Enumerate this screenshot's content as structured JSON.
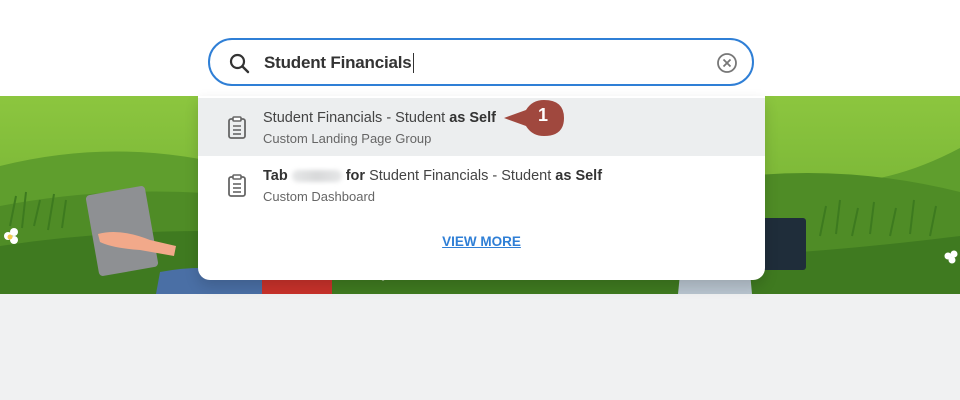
{
  "search": {
    "value": "Student Financials",
    "icon": "search-icon",
    "clear_icon": "clear-icon"
  },
  "results": [
    {
      "title_prefix": "Student Financials - Student ",
      "title_bold": "as Self",
      "subtitle": "Custom Landing Page Group",
      "icon": "clipboard-icon"
    },
    {
      "title_bold_1": "Tab",
      "title_bold_2": "for",
      "title_middle": "Student Financials - Student ",
      "title_bold_3": "as Self",
      "subtitle": "Custom Dashboard",
      "icon": "clipboard-icon"
    }
  ],
  "view_more": "VIEW MORE",
  "step_badge": "1",
  "colors": {
    "accent": "#2f7fd6",
    "badge": "#a0483e",
    "grass": "#6fb33a",
    "background_bottom": "#f0f1f2"
  }
}
